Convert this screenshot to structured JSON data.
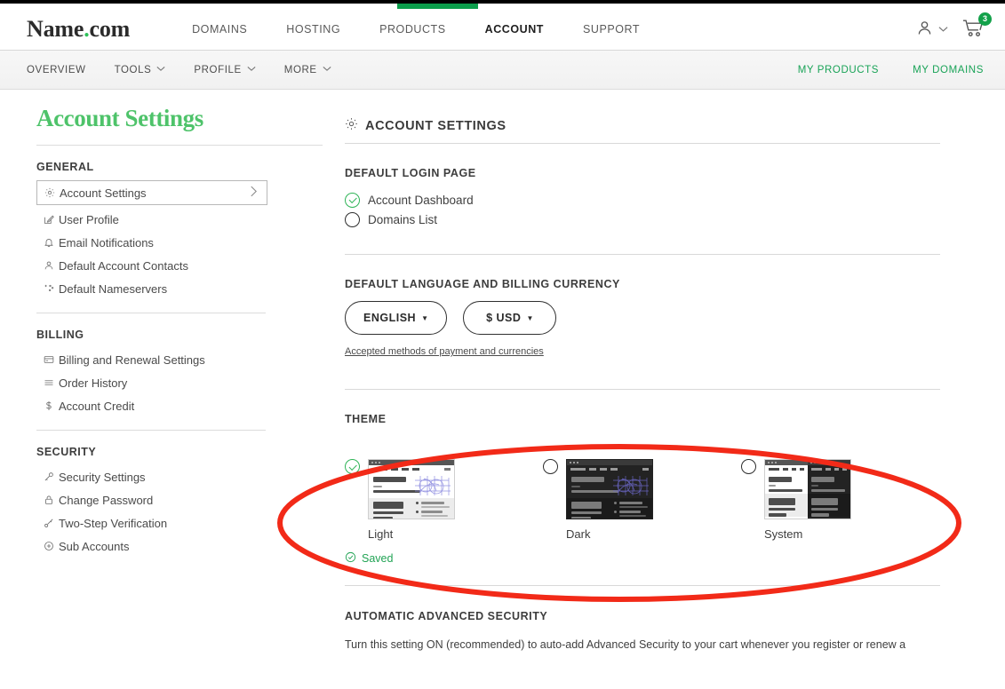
{
  "brand": {
    "logo_name": "Name",
    "logo_dot": ".",
    "logo_tld": "com",
    "accent_green": "#0b9e4b",
    "title_green": "#4ec36a"
  },
  "header": {
    "nav": [
      {
        "label": "DOMAINS",
        "active": false
      },
      {
        "label": "HOSTING",
        "active": false
      },
      {
        "label": "PRODUCTS",
        "active": false
      },
      {
        "label": "ACCOUNT",
        "active": true
      },
      {
        "label": "SUPPORT",
        "active": false
      }
    ],
    "account_icon": "user-icon",
    "cart_icon": "cart-icon",
    "cart_count": "3"
  },
  "subnav": {
    "left": [
      {
        "label": "OVERVIEW",
        "caret": false
      },
      {
        "label": "TOOLS",
        "caret": true
      },
      {
        "label": "PROFILE",
        "caret": true
      },
      {
        "label": "MORE",
        "caret": true
      }
    ],
    "right": [
      {
        "label": "MY PRODUCTS"
      },
      {
        "label": "MY DOMAINS"
      }
    ]
  },
  "sidebar": {
    "title": "Account Settings",
    "groups": [
      {
        "title": "GENERAL",
        "items": [
          {
            "label": "Account Settings",
            "icon": "gear-icon",
            "glyph": "⚙",
            "active": true
          },
          {
            "label": "User Profile",
            "icon": "edit-square-icon",
            "glyph": "☐",
            "active": false
          },
          {
            "label": "Email Notifications",
            "icon": "bell-icon",
            "glyph": "☐",
            "active": false
          },
          {
            "label": "Default Account Contacts",
            "icon": "contacts-icon",
            "glyph": "☐",
            "active": false
          },
          {
            "label": "Default Nameservers",
            "icon": "nameservers-icon",
            "glyph": "☐",
            "active": false
          }
        ]
      },
      {
        "title": "BILLING",
        "items": [
          {
            "label": "Billing and Renewal Settings",
            "icon": "credit-card-icon",
            "glyph": "☐",
            "active": false
          },
          {
            "label": "Order History",
            "icon": "list-icon",
            "glyph": "≡",
            "active": false
          },
          {
            "label": "Account Credit",
            "icon": "dollar-icon",
            "glyph": "$",
            "active": false
          }
        ]
      },
      {
        "title": "SECURITY",
        "items": [
          {
            "label": "Security Settings",
            "icon": "key-icon",
            "glyph": "☐",
            "active": false
          },
          {
            "label": "Change Password",
            "icon": "lock-icon",
            "glyph": "☐",
            "active": false
          },
          {
            "label": "Two-Step Verification",
            "icon": "two-step-icon",
            "glyph": "☐",
            "active": false
          },
          {
            "label": "Sub Accounts",
            "icon": "plus-circle-icon",
            "glyph": "⊕",
            "active": false
          }
        ]
      }
    ]
  },
  "main": {
    "heading": "ACCOUNT SETTINGS",
    "heading_icon": "gear-icon",
    "default_login": {
      "title": "DEFAULT LOGIN PAGE",
      "options": [
        {
          "label": "Account Dashboard",
          "selected": true
        },
        {
          "label": "Domains List",
          "selected": false
        }
      ]
    },
    "language_currency": {
      "title": "DEFAULT LANGUAGE AND BILLING CURRENCY",
      "language_value": "ENGLISH",
      "currency_value": "$ USD",
      "link": "Accepted methods of payment and currencies"
    },
    "theme": {
      "title": "THEME",
      "options": [
        {
          "label": "Light",
          "selected": true,
          "kind": "light"
        },
        {
          "label": "Dark",
          "selected": false,
          "kind": "dark"
        },
        {
          "label": "System",
          "selected": false,
          "kind": "system"
        }
      ],
      "status": "Saved",
      "status_icon": "check-circle-icon"
    },
    "advanced_security": {
      "title": "AUTOMATIC ADVANCED SECURITY",
      "body": "Turn this setting ON (recommended) to auto-add Advanced Security to your cart whenever you register or renew a"
    }
  },
  "annotation": {
    "shape": "red-ellipse-highlight",
    "color": "#f22a18"
  }
}
